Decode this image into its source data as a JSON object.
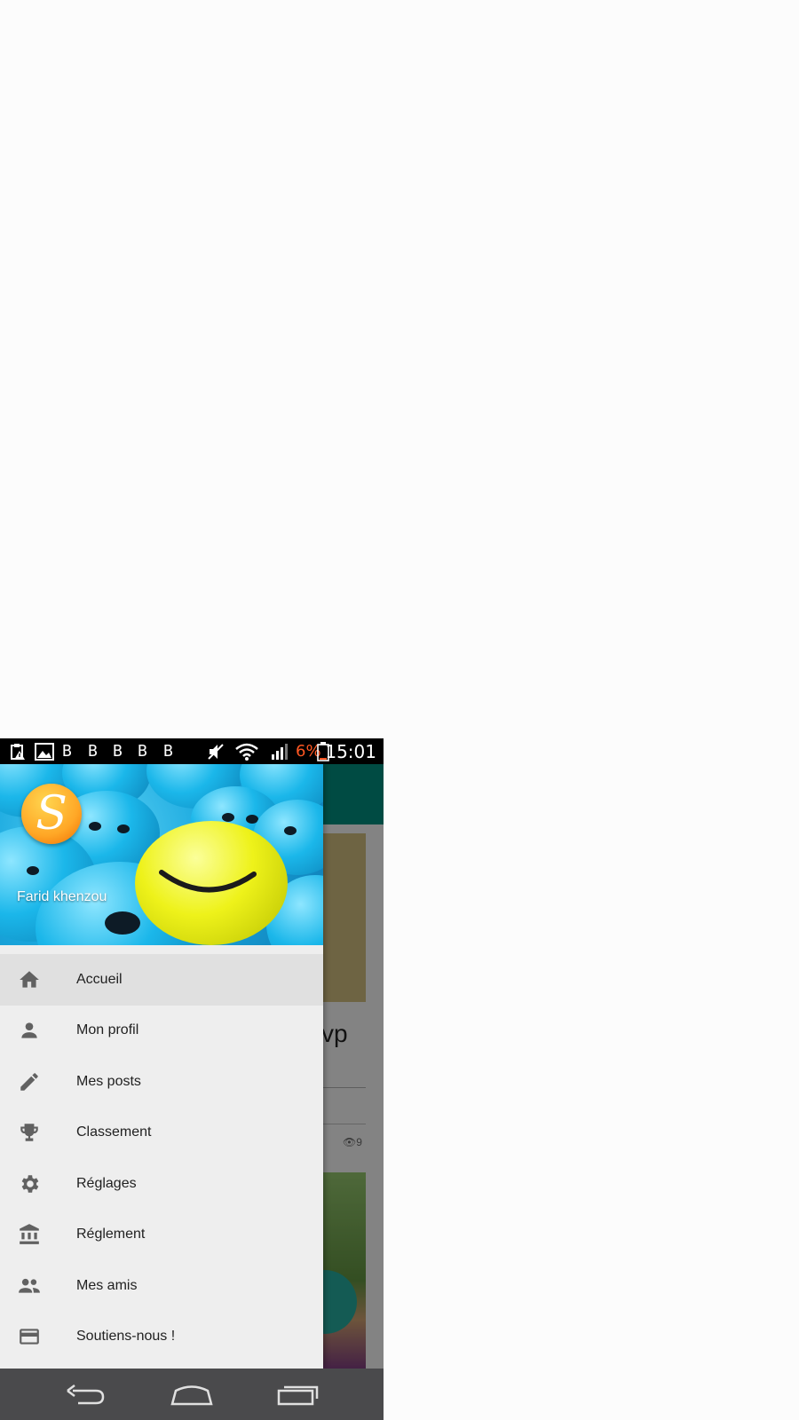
{
  "status_bar": {
    "time": "15:01",
    "battery_percent": "6%",
    "notification_icons": [
      "clipboard-warning-icon",
      "image-icon",
      "b-icon",
      "b-icon",
      "b-icon",
      "b-icon",
      "b-icon"
    ],
    "b_glyph": "B",
    "colors": {
      "battery_low": "#ff5722"
    }
  },
  "background_app": {
    "title_fragment": "vp",
    "views_count": "9",
    "colors": {
      "toolbar": "#00897b",
      "fab": "#26a69a"
    }
  },
  "drawer": {
    "user_name": "Farid khenzou",
    "logo_letter": "S",
    "menu": [
      {
        "label": "Accueil",
        "icon": "home-icon",
        "active": true
      },
      {
        "label": "Mon profil",
        "icon": "person-icon",
        "active": false
      },
      {
        "label": "Mes posts",
        "icon": "pencil-icon",
        "active": false
      },
      {
        "label": "Classement",
        "icon": "trophy-icon",
        "active": false
      },
      {
        "label": "Réglages",
        "icon": "gear-icon",
        "active": false
      },
      {
        "label": "Réglement",
        "icon": "bank-icon",
        "active": false
      },
      {
        "label": "Mes amis",
        "icon": "people-icon",
        "active": false
      },
      {
        "label": "Soutiens-nous !",
        "icon": "credit-card-icon",
        "active": false
      }
    ]
  },
  "nav_bar": {
    "buttons": [
      "back-icon",
      "home-icon",
      "recent-apps-icon"
    ]
  }
}
